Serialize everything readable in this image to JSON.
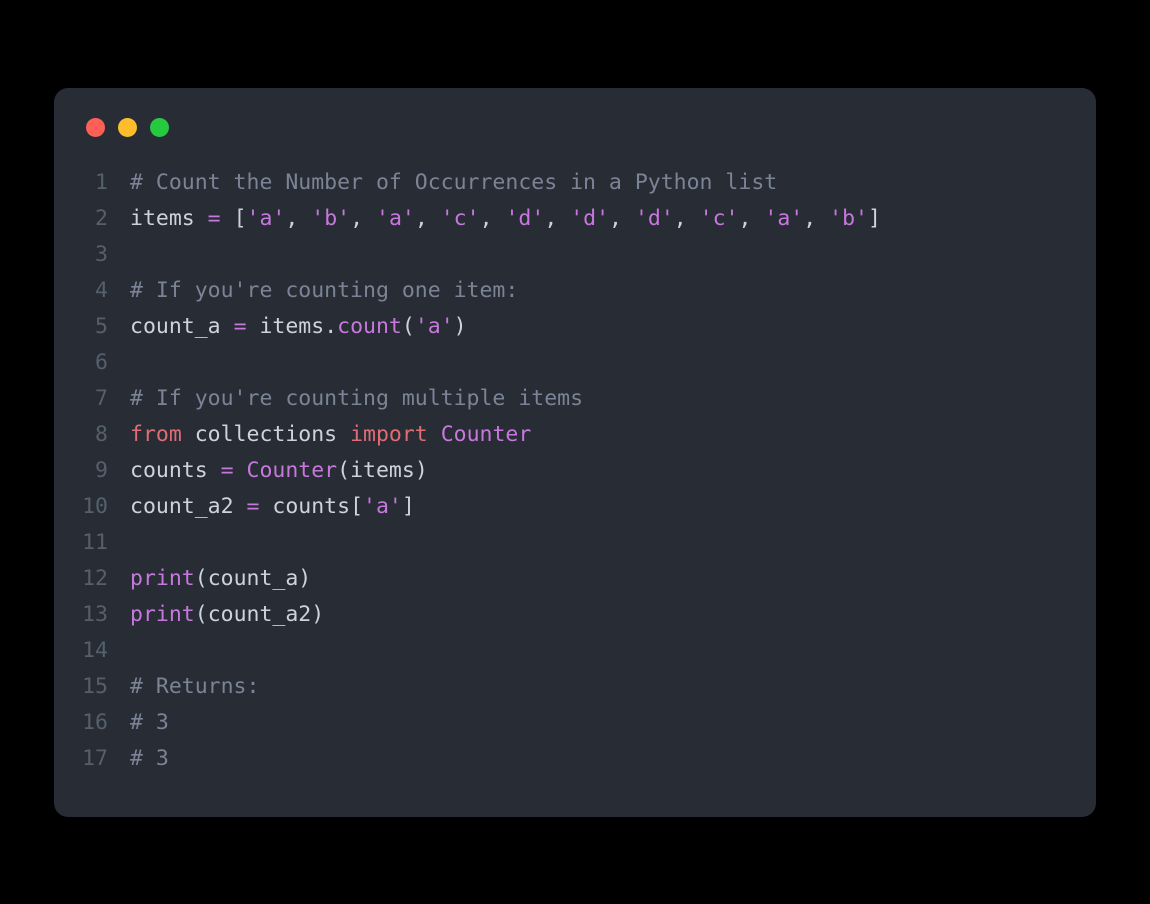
{
  "window": {
    "buttons": [
      "close",
      "minimize",
      "zoom"
    ]
  },
  "code": {
    "lines": [
      {
        "n": "1",
        "tokens": [
          {
            "cls": "tok-comment",
            "t": "# Count the Number of Occurrences in a Python list"
          }
        ]
      },
      {
        "n": "2",
        "tokens": [
          {
            "cls": "tok-default",
            "t": "items "
          },
          {
            "cls": "tok-op",
            "t": "="
          },
          {
            "cls": "tok-default",
            "t": " "
          },
          {
            "cls": "tok-punct",
            "t": "["
          },
          {
            "cls": "tok-string",
            "t": "'a'"
          },
          {
            "cls": "tok-punct",
            "t": ", "
          },
          {
            "cls": "tok-string",
            "t": "'b'"
          },
          {
            "cls": "tok-punct",
            "t": ", "
          },
          {
            "cls": "tok-string",
            "t": "'a'"
          },
          {
            "cls": "tok-punct",
            "t": ", "
          },
          {
            "cls": "tok-string",
            "t": "'c'"
          },
          {
            "cls": "tok-punct",
            "t": ", "
          },
          {
            "cls": "tok-string",
            "t": "'d'"
          },
          {
            "cls": "tok-punct",
            "t": ", "
          },
          {
            "cls": "tok-string",
            "t": "'d'"
          },
          {
            "cls": "tok-punct",
            "t": ", "
          },
          {
            "cls": "tok-string",
            "t": "'d'"
          },
          {
            "cls": "tok-punct",
            "t": ", "
          },
          {
            "cls": "tok-string",
            "t": "'c'"
          },
          {
            "cls": "tok-punct",
            "t": ", "
          },
          {
            "cls": "tok-string",
            "t": "'a'"
          },
          {
            "cls": "tok-punct",
            "t": ", "
          },
          {
            "cls": "tok-string",
            "t": "'b'"
          },
          {
            "cls": "tok-punct",
            "t": "]"
          }
        ]
      },
      {
        "n": "3",
        "tokens": []
      },
      {
        "n": "4",
        "tokens": [
          {
            "cls": "tok-comment",
            "t": "# If you're counting one item:"
          }
        ]
      },
      {
        "n": "5",
        "tokens": [
          {
            "cls": "tok-default",
            "t": "count_a "
          },
          {
            "cls": "tok-op",
            "t": "="
          },
          {
            "cls": "tok-default",
            "t": " items"
          },
          {
            "cls": "tok-punct",
            "t": "."
          },
          {
            "cls": "tok-func",
            "t": "count"
          },
          {
            "cls": "tok-punct",
            "t": "("
          },
          {
            "cls": "tok-string",
            "t": "'a'"
          },
          {
            "cls": "tok-punct",
            "t": ")"
          }
        ]
      },
      {
        "n": "6",
        "tokens": []
      },
      {
        "n": "7",
        "tokens": [
          {
            "cls": "tok-comment",
            "t": "# If you're counting multiple items"
          }
        ]
      },
      {
        "n": "8",
        "tokens": [
          {
            "cls": "tok-keyword",
            "t": "from"
          },
          {
            "cls": "tok-default",
            "t": " collections "
          },
          {
            "cls": "tok-keyword",
            "t": "import"
          },
          {
            "cls": "tok-default",
            "t": " "
          },
          {
            "cls": "tok-class",
            "t": "Counter"
          }
        ]
      },
      {
        "n": "9",
        "tokens": [
          {
            "cls": "tok-default",
            "t": "counts "
          },
          {
            "cls": "tok-op",
            "t": "="
          },
          {
            "cls": "tok-default",
            "t": " "
          },
          {
            "cls": "tok-class",
            "t": "Counter"
          },
          {
            "cls": "tok-punct",
            "t": "("
          },
          {
            "cls": "tok-default",
            "t": "items"
          },
          {
            "cls": "tok-punct",
            "t": ")"
          }
        ]
      },
      {
        "n": "10",
        "tokens": [
          {
            "cls": "tok-default",
            "t": "count_a2 "
          },
          {
            "cls": "tok-op",
            "t": "="
          },
          {
            "cls": "tok-default",
            "t": " counts"
          },
          {
            "cls": "tok-punct",
            "t": "["
          },
          {
            "cls": "tok-string",
            "t": "'a'"
          },
          {
            "cls": "tok-punct",
            "t": "]"
          }
        ]
      },
      {
        "n": "11",
        "tokens": []
      },
      {
        "n": "12",
        "tokens": [
          {
            "cls": "tok-func",
            "t": "print"
          },
          {
            "cls": "tok-punct",
            "t": "("
          },
          {
            "cls": "tok-default",
            "t": "count_a"
          },
          {
            "cls": "tok-punct",
            "t": ")"
          }
        ]
      },
      {
        "n": "13",
        "tokens": [
          {
            "cls": "tok-func",
            "t": "print"
          },
          {
            "cls": "tok-punct",
            "t": "("
          },
          {
            "cls": "tok-default",
            "t": "count_a2"
          },
          {
            "cls": "tok-punct",
            "t": ")"
          }
        ]
      },
      {
        "n": "14",
        "tokens": []
      },
      {
        "n": "15",
        "tokens": [
          {
            "cls": "tok-comment",
            "t": "# Returns:"
          }
        ]
      },
      {
        "n": "16",
        "tokens": [
          {
            "cls": "tok-comment",
            "t": "# 3"
          }
        ]
      },
      {
        "n": "17",
        "tokens": [
          {
            "cls": "tok-comment",
            "t": "# 3"
          }
        ]
      }
    ]
  }
}
